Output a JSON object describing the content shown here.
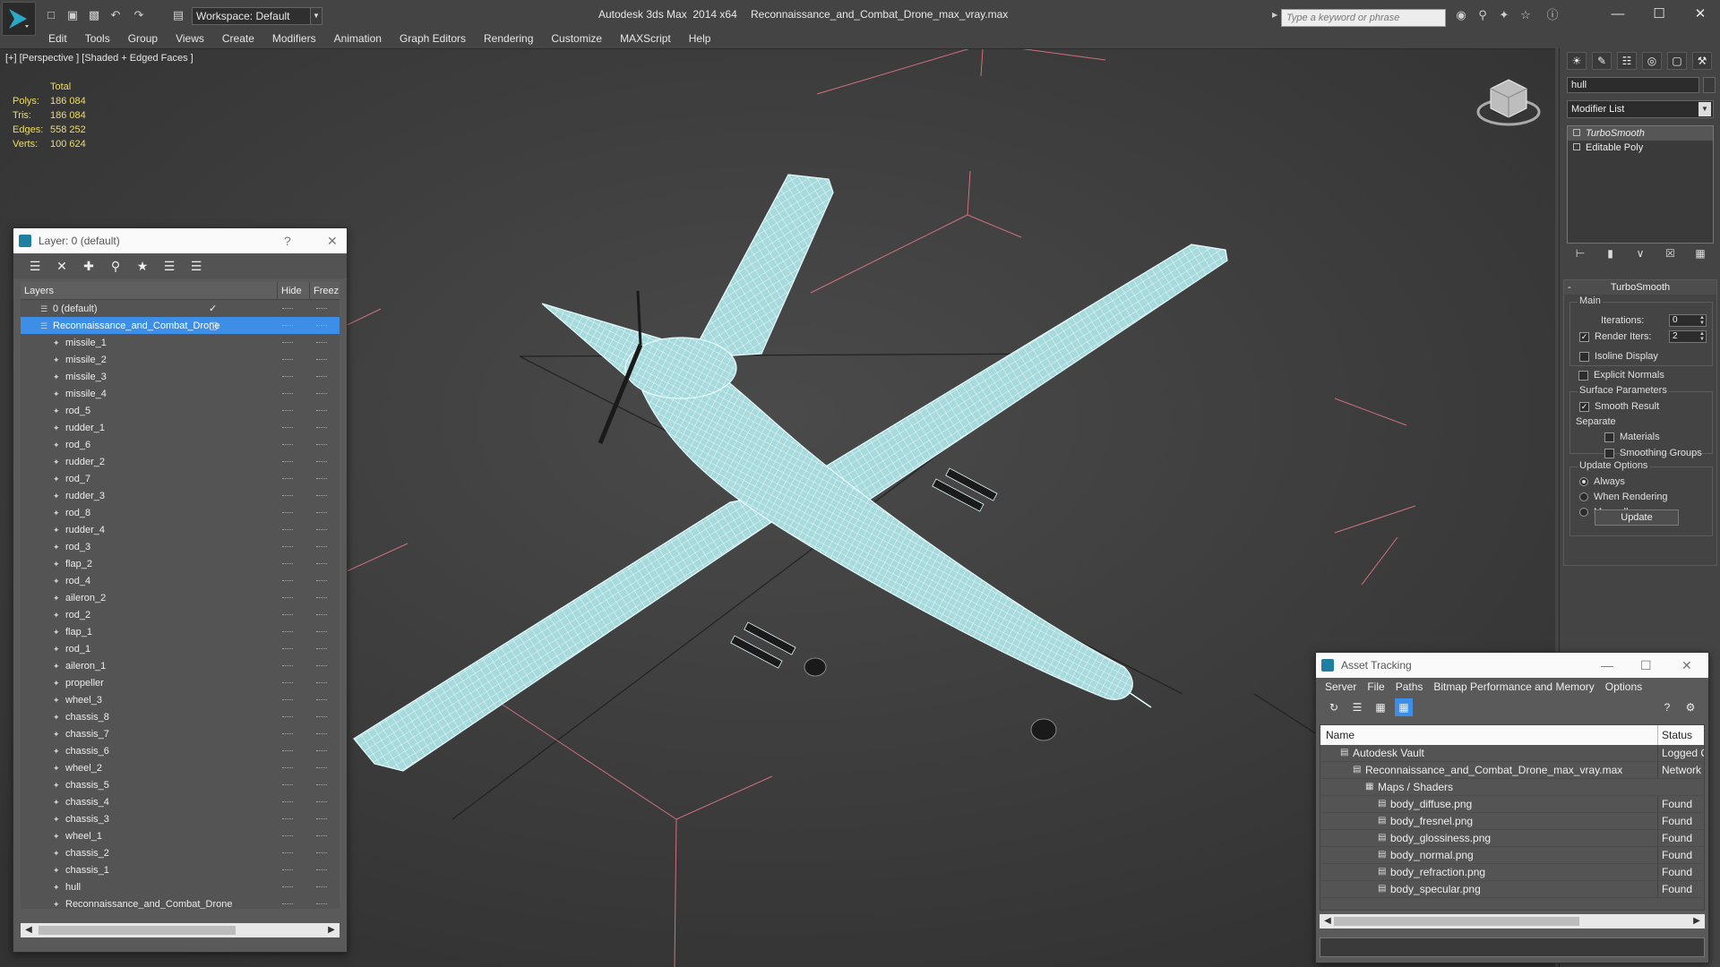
{
  "app": {
    "title": "Autodesk 3ds Max  2014 x64",
    "document": "Reconnaissance_and_Combat_Drone_max_vray.max",
    "workspace": "Workspace: Default",
    "search_placeholder": "Type a keyword or phrase"
  },
  "menu": [
    "Edit",
    "Tools",
    "Group",
    "Views",
    "Create",
    "Modifiers",
    "Animation",
    "Graph Editors",
    "Rendering",
    "Customize",
    "MAXScript",
    "Help"
  ],
  "viewport": {
    "label": "[+] [Perspective ] [Shaded + Edged Faces ]",
    "stats": {
      "header": "Total",
      "rows": [
        {
          "k": "Polys:",
          "v": "186 084"
        },
        {
          "k": "Tris:",
          "v": "186 084"
        },
        {
          "k": "Edges:",
          "v": "558 252"
        },
        {
          "k": "Verts:",
          "v": "100 624"
        }
      ]
    }
  },
  "layer_panel": {
    "title": "Layer: 0 (default)",
    "help": "?",
    "close": "✕",
    "col_layers": "Layers",
    "col_hide": "Hide",
    "col_freeze": "Freez",
    "rows": [
      {
        "name": "0 (default)",
        "level": 0,
        "mark": "✓"
      },
      {
        "name": "Reconnaissance_and_Combat_Drone",
        "level": 0,
        "selected": true,
        "mark": "▢"
      },
      {
        "name": "missile_1",
        "level": 1
      },
      {
        "name": "missile_2",
        "level": 1
      },
      {
        "name": "missile_3",
        "level": 1
      },
      {
        "name": "missile_4",
        "level": 1
      },
      {
        "name": "rod_5",
        "level": 1
      },
      {
        "name": "rudder_1",
        "level": 1
      },
      {
        "name": "rod_6",
        "level": 1
      },
      {
        "name": "rudder_2",
        "level": 1
      },
      {
        "name": "rod_7",
        "level": 1
      },
      {
        "name": "rudder_3",
        "level": 1
      },
      {
        "name": "rod_8",
        "level": 1
      },
      {
        "name": "rudder_4",
        "level": 1
      },
      {
        "name": "rod_3",
        "level": 1
      },
      {
        "name": "flap_2",
        "level": 1
      },
      {
        "name": "rod_4",
        "level": 1
      },
      {
        "name": "aileron_2",
        "level": 1
      },
      {
        "name": "rod_2",
        "level": 1
      },
      {
        "name": "flap_1",
        "level": 1
      },
      {
        "name": "rod_1",
        "level": 1
      },
      {
        "name": "aileron_1",
        "level": 1
      },
      {
        "name": "propeller",
        "level": 1
      },
      {
        "name": "wheel_3",
        "level": 1
      },
      {
        "name": "chassis_8",
        "level": 1
      },
      {
        "name": "chassis_7",
        "level": 1
      },
      {
        "name": "chassis_6",
        "level": 1
      },
      {
        "name": "wheel_2",
        "level": 1
      },
      {
        "name": "chassis_5",
        "level": 1
      },
      {
        "name": "chassis_4",
        "level": 1
      },
      {
        "name": "chassis_3",
        "level": 1
      },
      {
        "name": "wheel_1",
        "level": 1
      },
      {
        "name": "chassis_2",
        "level": 1
      },
      {
        "name": "chassis_1",
        "level": 1
      },
      {
        "name": "hull",
        "level": 1
      },
      {
        "name": "Reconnaissance_and_Combat_Drone",
        "level": 1
      }
    ]
  },
  "command_panel": {
    "object_name": "hull",
    "modifier_list": "Modifier List",
    "stack": [
      "TurboSmooth",
      "Editable Poly"
    ],
    "turbosmooth": {
      "title": "TurboSmooth",
      "main": "Main",
      "iterations_label": "Iterations:",
      "iterations": "0",
      "render_iters_label": "Render Iters:",
      "render_iters": "2",
      "isoline": "Isoline Display",
      "explicit": "Explicit Normals",
      "surface": "Surface Parameters",
      "smooth_result": "Smooth Result",
      "separate": "Separate",
      "materials": "Materials",
      "smoothing_groups": "Smoothing Groups",
      "update_options": "Update Options",
      "always": "Always",
      "when_rendering": "When Rendering",
      "manually": "Manually",
      "update": "Update"
    }
  },
  "asset_tracking": {
    "title": "Asset Tracking",
    "menu": [
      "Server",
      "File",
      "Paths",
      "Bitmap Performance and Memory",
      "Options"
    ],
    "col_name": "Name",
    "col_status": "Status",
    "rows": [
      {
        "name": "Autodesk Vault",
        "status": "Logged O",
        "indent": 1
      },
      {
        "name": "Reconnaissance_and_Combat_Drone_max_vray.max",
        "status": "Network",
        "indent": 2
      },
      {
        "name": "Maps / Shaders",
        "status": "",
        "indent": 3
      },
      {
        "name": "body_diffuse.png",
        "status": "Found",
        "indent": 4
      },
      {
        "name": "body_fresnel.png",
        "status": "Found",
        "indent": 4
      },
      {
        "name": "body_glossiness.png",
        "status": "Found",
        "indent": 4
      },
      {
        "name": "body_normal.png",
        "status": "Found",
        "indent": 4
      },
      {
        "name": "body_refraction.png",
        "status": "Found",
        "indent": 4
      },
      {
        "name": "body_specular.png",
        "status": "Found",
        "indent": 4
      }
    ]
  },
  "colors": {
    "accent": "#3d8ee6",
    "mesh": "#a8dde0",
    "stats": "#eedd66",
    "grid_red": "#d07080"
  }
}
